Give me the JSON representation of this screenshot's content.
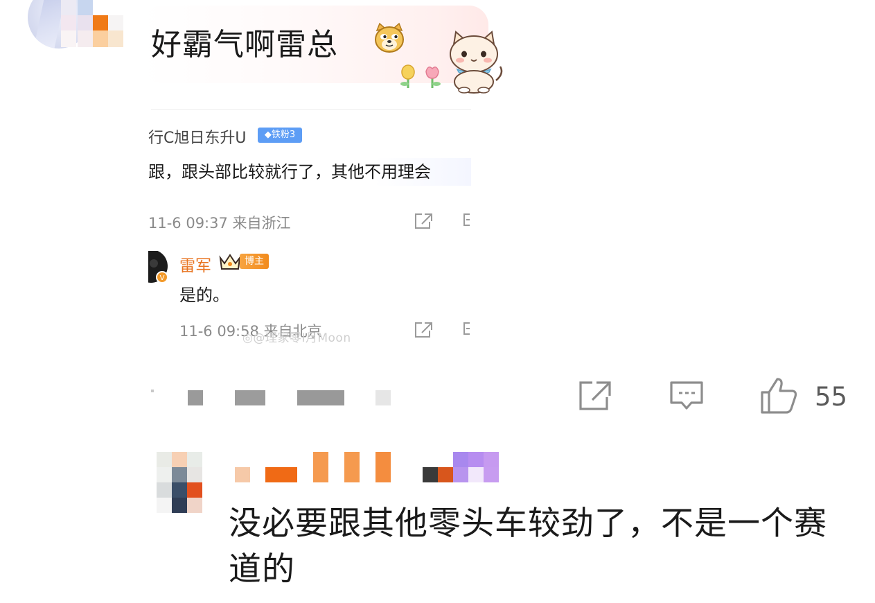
{
  "top_comment": {
    "text": "好霸气啊雷总",
    "emoji_icon": "doge-emoji-icon",
    "sticker_icon": "cat-sticker-icon"
  },
  "quoted_screenshot": {
    "username": "行C旭日东升U",
    "fan_badge": "铁粉3",
    "comment_text": "跟，跟头部比较就行了，其他不用理会",
    "meta": "11-6 09:37 来自浙江",
    "reply": {
      "name": "雷军",
      "badge": "博主",
      "text": "是的。",
      "meta": "11-6 09:58 来自北京"
    },
    "watermark": "@理家零Ⅰ月Moon"
  },
  "actions": {
    "like_count": "55"
  },
  "second_comment": {
    "text": "没必要跟其他零头车较劲了，不是一个赛道的"
  },
  "colors": {
    "accent_orange": "#e8731f",
    "fan_badge_blue": "#5d9df5",
    "icon_gray": "#8d8d8d"
  }
}
